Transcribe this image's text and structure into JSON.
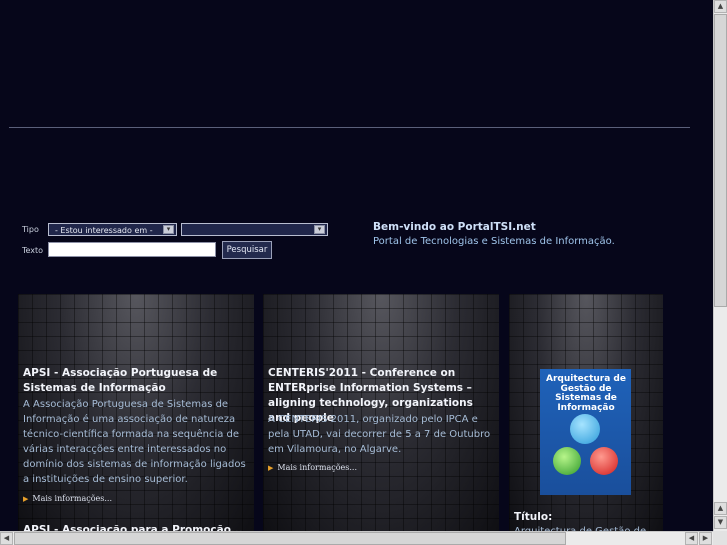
{
  "search": {
    "tipo_label": "Tipo",
    "texto_label": "Texto",
    "tipo_select_value": "- Estou interessado em -",
    "second_select_value": "",
    "texto_value": "",
    "submit_label": "Pesquisar"
  },
  "welcome": {
    "title": "Bem-vindo ao PortalTSI.net",
    "subtitle": "Portal de Tecnologias e Sistemas de Informação."
  },
  "cards": [
    {
      "title": "APSI - Associação Portuguesa de Sistemas de Informação",
      "body": "A Associação Portuguesa de Sistemas de Informação é uma associação de natureza técnico-científica formada na sequência de várias interacções entre interessados no domínio dos sistemas de informação ligados a instituições de ensino superior.",
      "more": "Mais informações...",
      "next_title": "APSI - Associação para a Promoção..."
    },
    {
      "title": "CENTERIS'2011 - Conference on ENTERprise Information Systems – aligning technology, organizations and people",
      "body": "A CENTERIS 2011, organizado pelo IPCA e pela UTAD, vai decorrer de 5 a 7 de Outubro em Vilamoura, no Algarve.",
      "more": "Mais informações..."
    },
    {
      "book_title": "Arquitectura de Gestão de Sistemas de Informação",
      "label": "Título:",
      "next_text": "Arquitectura de Gestão de..."
    }
  ],
  "colors": {
    "background": "#06061a",
    "welcome_text": "#9fc4ea",
    "card_body_text": "#a6bcd6",
    "accent_arrow": "#e8a02a"
  },
  "icons": {
    "dropdown": "chevron-down-icon",
    "more_bullet": "triangle-right-icon",
    "scroll_up": "arrow-up-icon",
    "scroll_down": "arrow-down-icon",
    "scroll_left": "arrow-left-icon",
    "scroll_right": "arrow-right-icon"
  }
}
